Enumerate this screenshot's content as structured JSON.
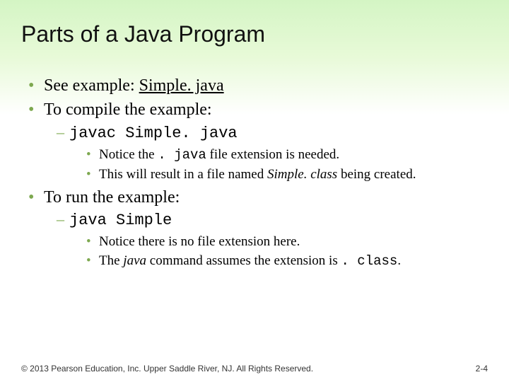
{
  "title": "Parts of a Java Program",
  "bullets": {
    "see_example_prefix": "See example: ",
    "see_example_link": "Simple. java",
    "compile": "To compile the example:",
    "compile_cmd": "javac Simple. java",
    "notice_prefix": "Notice the ",
    "notice_mono": ". java",
    "notice_suffix": " file extension is needed.",
    "result_prefix": "This will result in a file named ",
    "result_italic": "Simple. class",
    "result_suffix": " being created.",
    "run": "To run the example:",
    "run_cmd": "java Simple",
    "no_ext": "Notice there is no file extension here.",
    "assumes_prefix": "The ",
    "assumes_italic": "java",
    "assumes_mid": " command assumes the extension is ",
    "assumes_mono": ". class",
    "assumes_suffix": "."
  },
  "footer": {
    "copyright": "© 2013 Pearson Education, Inc. Upper Saddle River, NJ. All Rights Reserved.",
    "page": "2-4"
  }
}
